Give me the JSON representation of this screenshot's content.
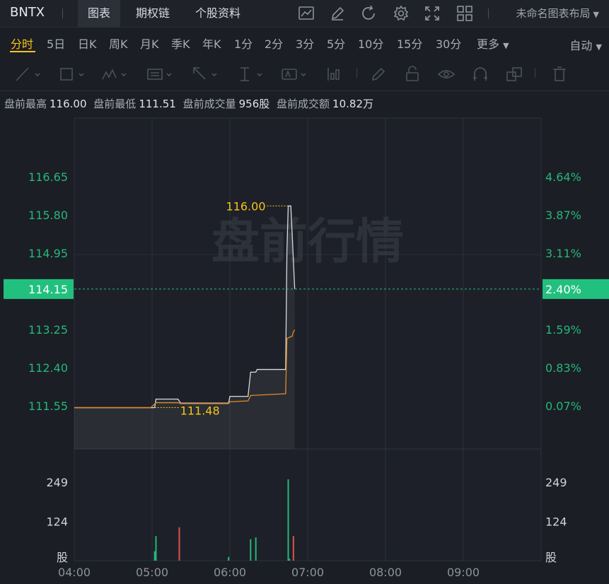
{
  "ticker": "BNTX",
  "top_tabs": [
    "图表",
    "期权链",
    "个股资料"
  ],
  "layout_name": "未命名图表布局",
  "periods": [
    "分时",
    "5日",
    "日K",
    "周K",
    "月K",
    "季K",
    "年K",
    "1分",
    "2分",
    "3分",
    "5分",
    "10分",
    "15分",
    "30分",
    "更多"
  ],
  "active_period": "分时",
  "auto_label": "自动",
  "info": {
    "high_label": "盘前最高",
    "high": "116.00",
    "low_label": "盘前最低",
    "low": "111.51",
    "vol_label": "盘前成交量",
    "vol": "956股",
    "amt_label": "盘前成交额",
    "amt": "10.82万"
  },
  "watermark": "盘前行情",
  "colors": {
    "up": "#25b779",
    "down": "#e0514f",
    "accent": "#f5c518",
    "price_line": "#d9dadf",
    "avg_line": "#e08a2c",
    "current_bg": "#22c07e"
  },
  "chart_data": {
    "type": "line",
    "x_ticks": [
      "04:00",
      "05:00",
      "06:00",
      "07:00",
      "08:00",
      "09:00"
    ],
    "price_axis_left": [
      "116.65",
      "115.80",
      "114.95",
      "114.15",
      "113.25",
      "112.40",
      "111.55"
    ],
    "price_axis_right": [
      "4.64%",
      "3.87%",
      "3.11%",
      "2.40%",
      "1.59%",
      "0.83%",
      "0.07%"
    ],
    "current_price": "114.15",
    "current_pct": "2.40%",
    "high_label": "116.00",
    "low_label": "111.48",
    "volume_axis": [
      "249",
      "124",
      "股"
    ],
    "price_series": [
      [
        "04:00",
        111.51
      ],
      [
        "04:59",
        111.51
      ],
      [
        "05:02",
        111.51
      ],
      [
        "05:03",
        111.7
      ],
      [
        "05:20",
        111.7
      ],
      [
        "05:22",
        111.61
      ],
      [
        "05:59",
        111.61
      ],
      [
        "06:00",
        111.76
      ],
      [
        "06:14",
        111.76
      ],
      [
        "06:16",
        112.3
      ],
      [
        "06:20",
        112.3
      ],
      [
        "06:21",
        112.36
      ],
      [
        "06:43",
        112.36
      ],
      [
        "06:44",
        115.0
      ],
      [
        "06:45",
        116.0
      ],
      [
        "06:47",
        116.0
      ],
      [
        "06:48",
        115.4
      ],
      [
        "06:50",
        114.15
      ]
    ],
    "avg_series": [
      [
        "04:00",
        111.51
      ],
      [
        "04:59",
        111.51
      ],
      [
        "05:03",
        111.62
      ],
      [
        "05:20",
        111.62
      ],
      [
        "05:22",
        111.6
      ],
      [
        "05:59",
        111.6
      ],
      [
        "06:00",
        111.64
      ],
      [
        "06:14",
        111.66
      ],
      [
        "06:16",
        111.78
      ],
      [
        "06:43",
        111.82
      ],
      [
        "06:44",
        113.05
      ],
      [
        "06:48",
        113.1
      ],
      [
        "06:49",
        113.2
      ],
      [
        "06:50",
        113.24
      ]
    ],
    "volume": [
      {
        "t": "05:02",
        "v": 30,
        "dir": "up"
      },
      {
        "t": "05:03",
        "v": 78,
        "dir": "up"
      },
      {
        "t": "05:21",
        "v": 106,
        "dir": "down"
      },
      {
        "t": "05:59",
        "v": 12,
        "dir": "up"
      },
      {
        "t": "06:16",
        "v": 68,
        "dir": "up"
      },
      {
        "t": "06:20",
        "v": 74,
        "dir": "up"
      },
      {
        "t": "06:45",
        "v": 258,
        "dir": "up"
      },
      {
        "t": "06:46",
        "v": 6,
        "dir": "up"
      },
      {
        "t": "06:49",
        "v": 78,
        "dir": "down"
      }
    ]
  }
}
